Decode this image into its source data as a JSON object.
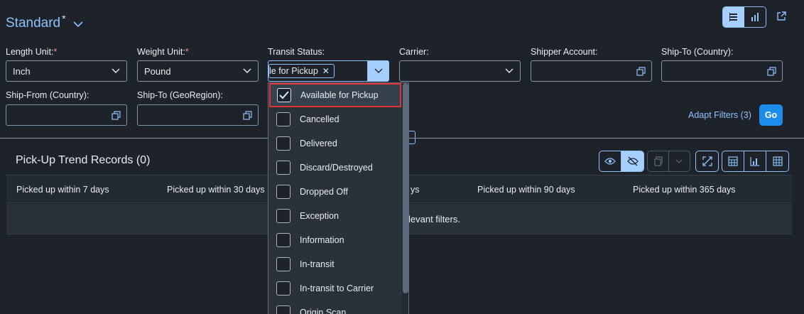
{
  "variant": {
    "title": "Standard",
    "modified_marker": "*"
  },
  "filters": {
    "length_unit": {
      "label": "Length Unit:",
      "required": "*",
      "value": "Inch"
    },
    "weight_unit": {
      "label": "Weight Unit:",
      "required": "*",
      "value": "Pound"
    },
    "transit_status": {
      "label": "Transit Status:",
      "token": "le for Pickup"
    },
    "carrier": {
      "label": "Carrier:",
      "value": ""
    },
    "shipper_account": {
      "label": "Shipper Account:",
      "value": ""
    },
    "ship_to_country": {
      "label": "Ship-To (Country):",
      "value": ""
    },
    "ship_from_country": {
      "label": "Ship-From (Country):",
      "value": ""
    },
    "ship_to_georegion": {
      "label": "Ship-To (GeoRegion):",
      "value": ""
    }
  },
  "adapt_filters_label": "Adapt Filters (3)",
  "go_label": "Go",
  "table": {
    "title": "Pick-Up Trend Records (0)",
    "columns": [
      "Picked up within 7 days",
      "Picked up within 30 days",
      "ys",
      "Picked up within 90 days",
      "Picked up within 365 days"
    ],
    "no_data_text": "levant filters."
  },
  "dropdown": {
    "items": [
      {
        "label": "Available for Pickup",
        "checked": true
      },
      {
        "label": "Cancelled",
        "checked": false
      },
      {
        "label": "Delivered",
        "checked": false
      },
      {
        "label": "Discard/Destroyed",
        "checked": false
      },
      {
        "label": "Dropped Off",
        "checked": false
      },
      {
        "label": "Exception",
        "checked": false
      },
      {
        "label": "Information",
        "checked": false
      },
      {
        "label": "In-transit",
        "checked": false
      },
      {
        "label": "In-transit to Carrier",
        "checked": false
      },
      {
        "label": "Origin Scan",
        "checked": false
      }
    ]
  },
  "colors": {
    "accent": "#8cc2ff",
    "button": "#1c8ded",
    "background": "#1d2328",
    "highlight": "#e13535"
  }
}
